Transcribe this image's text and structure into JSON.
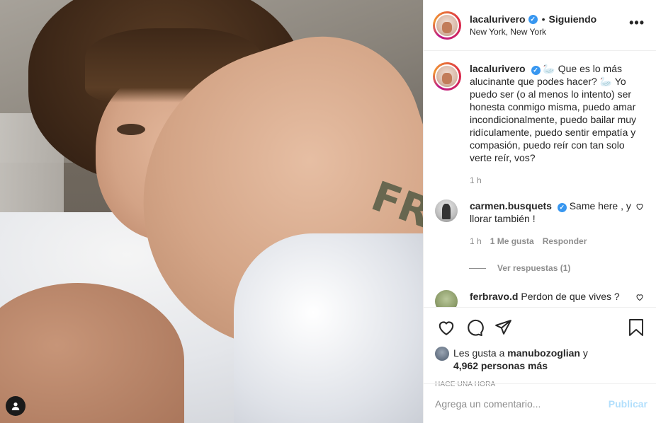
{
  "post": {
    "username": "lacalurivero",
    "follow_status": "Siguiendo",
    "location": "New York, New York",
    "more_label": "•••"
  },
  "caption": {
    "username": "lacalurivero",
    "text": "🦢 Que es lo más alucinante que podes hacer? 🦢 Yo puedo ser (o al menos lo intento) ser honesta conmigo misma, puedo amar incondicionalmente, puedo bailar muy ridículamente, puedo sentir empatía y compasión, puedo reír con tan solo verte reír, vos?",
    "time": "1 h"
  },
  "comments": [
    {
      "username": "carmen.busquets",
      "text": "Same here , y llorar también !",
      "time": "1 h",
      "likes": "1 Me gusta",
      "reply": "Responder",
      "view_replies": "Ver respuestas (1)"
    },
    {
      "username": "ferbravo.d",
      "text": "Perdon de que vives ?"
    }
  ],
  "likes": {
    "prefix": "Les gusta a",
    "user": "manubozoglian",
    "joiner": "y",
    "others": "4,962 personas más"
  },
  "timestamp": "HACE UNA HORA",
  "add_comment": {
    "placeholder": "Agrega un comentario...",
    "post_label": "Publicar"
  },
  "photo": {
    "tattoo_text": "FR"
  },
  "colors": {
    "verified": "#3897f0",
    "muted": "#8e8e8e",
    "publish_disabled": "#b2dffc"
  }
}
